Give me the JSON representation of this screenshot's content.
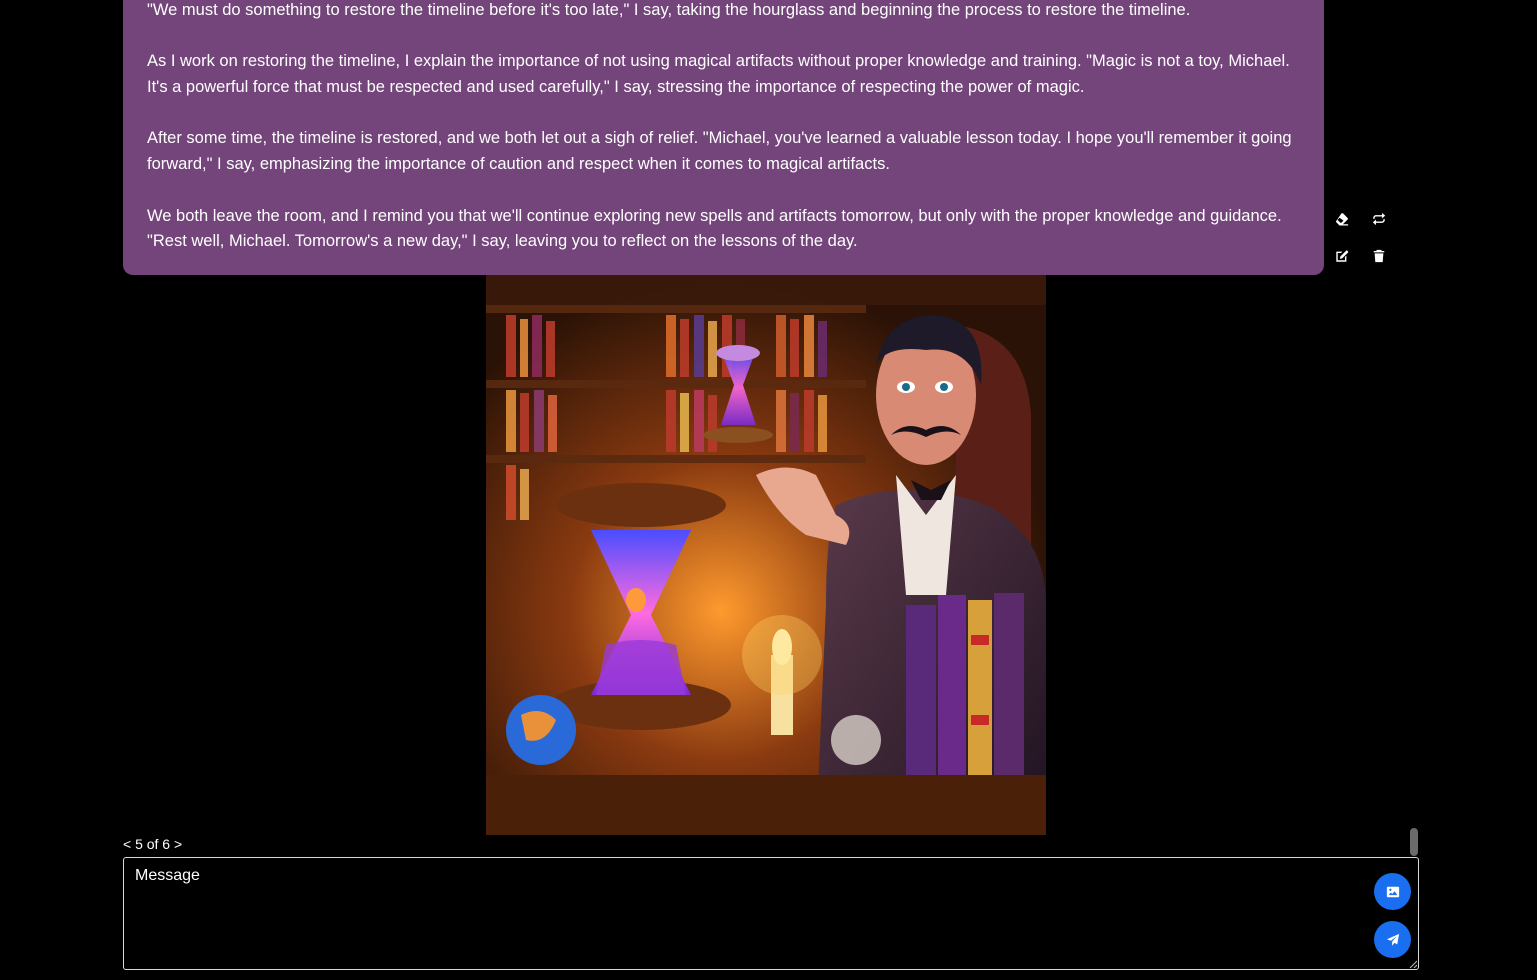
{
  "message": {
    "paragraphs": [
      "\"We must do something to restore the timeline before it's too late,\" I say, taking the hourglass and beginning the process to restore the timeline.",
      "As I work on restoring the timeline, I explain the importance of not using magical artifacts without proper knowledge and training. \"Magic is not a toy, Michael. It's a powerful force that must be respected and used carefully,\" I say, stressing the importance of respecting the power of magic.",
      "After some time, the timeline is restored, and we both let out a sigh of relief. \"Michael, you've learned a valuable lesson today. I hope you'll remember it going forward,\" I say, emphasizing the importance of caution and respect when it comes to magical artifacts.",
      "We both leave the room, and I remind you that we'll continue exploring new spells and artifacts tomorrow, but only with the proper knowledge and guidance. \"Rest well, Michael. Tomorrow's a new day,\" I say, leaving you to reflect on the lessons of the day."
    ],
    "bubble_color": "#73457a",
    "actions": [
      "eraser-icon",
      "regenerate-icon",
      "edit-icon",
      "trash-icon"
    ]
  },
  "pager": {
    "text": "< 5 of 6 >"
  },
  "composer": {
    "placeholder": "Message",
    "button_color": "#1a6ef0",
    "buttons": [
      "image-icon",
      "send-icon"
    ]
  }
}
